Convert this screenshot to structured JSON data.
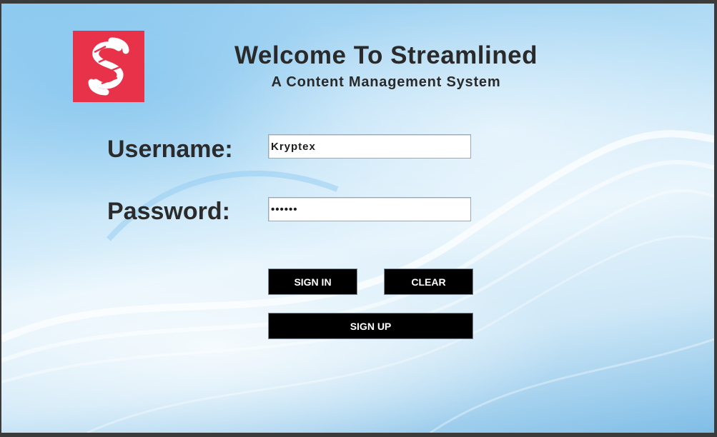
{
  "header": {
    "title": "Welcome To Streamlined",
    "subtitle": "A Content Management System"
  },
  "logo": {
    "icon": "streamlined-logo-icon",
    "color": "#e8324a"
  },
  "form": {
    "username_label": "Username:",
    "username_value": "Kryptex",
    "password_label": "Password:",
    "password_value": "••••••"
  },
  "buttons": {
    "sign_in": "SIGN IN",
    "clear": "CLEAR",
    "sign_up": "SIGN UP"
  },
  "colors": {
    "button_bg": "#000000",
    "button_text": "#ffffff",
    "heading_text": "#2a2a2a"
  }
}
